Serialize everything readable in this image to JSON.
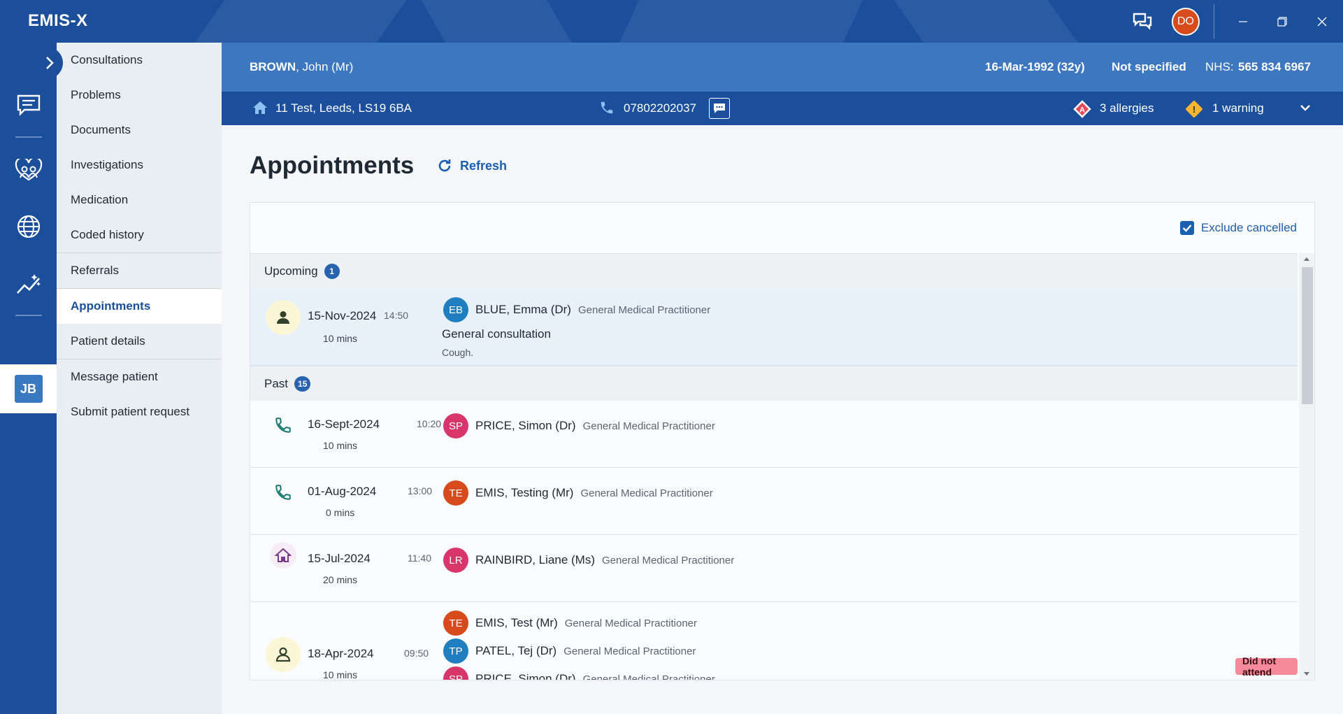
{
  "app": {
    "logo": "EMIS-X",
    "user_initials": "DO"
  },
  "rail": {
    "patient_initials": "JB"
  },
  "nav": {
    "items": [
      {
        "label": "Consultations"
      },
      {
        "label": "Problems"
      },
      {
        "label": "Documents"
      },
      {
        "label": "Investigations"
      },
      {
        "label": "Medication"
      },
      {
        "label": "Coded history"
      },
      {
        "label": "Referrals"
      },
      {
        "label": "Appointments",
        "active": true
      },
      {
        "label": "Patient details"
      },
      {
        "label": "Message patient"
      },
      {
        "label": "Submit patient request"
      }
    ]
  },
  "patient": {
    "surname": "BROWN",
    "forename_title": ", John (Mr)",
    "dob": "16-Mar-1992 (32y)",
    "gender": "Not specified",
    "nhs_label": "NHS:",
    "nhs_number": "565 834 6967",
    "address": "11 Test, Leeds, LS19 6BA",
    "phone": "07802202037",
    "allergies": "3 allergies",
    "warnings": "1 warning"
  },
  "page": {
    "title": "Appointments",
    "refresh_label": "Refresh",
    "exclude_cancelled_label": "Exclude cancelled",
    "exclude_cancelled_checked": true
  },
  "sections": {
    "upcoming": {
      "label": "Upcoming",
      "count": "1"
    },
    "past": {
      "label": "Past",
      "count": "15"
    }
  },
  "appointments": {
    "upcoming": [
      {
        "type_icon": "person-icon",
        "date": "15-Nov-2024",
        "time": "14:50",
        "duration": "10 mins",
        "clinicians": [
          {
            "initials": "EB",
            "name": "BLUE, Emma (Dr)",
            "role": "General Medical Practitioner",
            "color": "#1f7fc0"
          }
        ],
        "title": "General consultation",
        "note": "Cough."
      }
    ],
    "past": [
      {
        "type_icon": "phone-icon",
        "date": "16-Sept-2024",
        "time": "10:20",
        "duration": "10 mins",
        "clinicians": [
          {
            "initials": "SP",
            "name": "PRICE, Simon (Dr)",
            "role": "General Medical Practitioner",
            "color": "#d8366a"
          }
        ]
      },
      {
        "type_icon": "phone-icon",
        "date": "01-Aug-2024",
        "time": "13:00",
        "duration": "0 mins",
        "clinicians": [
          {
            "initials": "TE",
            "name": "EMIS, Testing (Mr)",
            "role": "General Medical Practitioner",
            "color": "#d64a1c"
          }
        ]
      },
      {
        "type_icon": "home-icon",
        "date": "15-Jul-2024",
        "time": "11:40",
        "duration": "20 mins",
        "clinicians": [
          {
            "initials": "LR",
            "name": "RAINBIRD, Liane (Ms)",
            "role": "General Medical Practitioner",
            "color": "#d8366a"
          }
        ]
      },
      {
        "type_icon": "person-icon",
        "date": "18-Apr-2024",
        "time": "09:50",
        "duration": "10 mins",
        "clinicians": [
          {
            "initials": "TE",
            "name": "EMIS, Test (Mr)",
            "role": "General Medical Practitioner",
            "color": "#d64a1c"
          },
          {
            "initials": "TP",
            "name": "PATEL, Tej (Dr)",
            "role": "General Medical Practitioner",
            "color": "#1f7fc0"
          },
          {
            "initials": "SP",
            "name": "PRICE, Simon (Dr)",
            "role": "General Medical Practitioner",
            "color": "#d8366a"
          }
        ],
        "status": "Did not attend"
      }
    ]
  },
  "colors": {
    "brand": "#1b4f9c",
    "banner": "#3d77c0",
    "accent": "#1b5fb0",
    "dna": "#f68a9a"
  }
}
